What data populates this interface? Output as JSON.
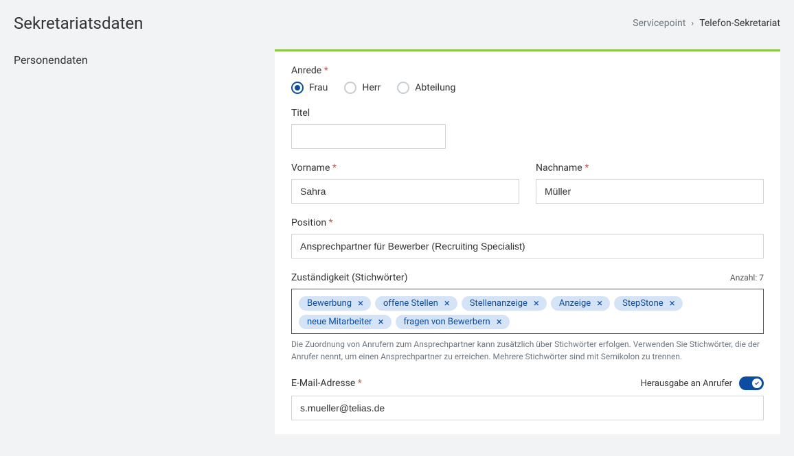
{
  "header": {
    "title": "Sekretariatsdaten",
    "breadcrumb": {
      "parent": "Servicepoint",
      "current": "Telefon-Sekretariat"
    }
  },
  "sidebar": {
    "items": [
      {
        "label": "Personendaten"
      }
    ]
  },
  "form": {
    "salutation": {
      "label": "Anrede",
      "options": [
        {
          "label": "Frau",
          "value": "frau",
          "checked": true
        },
        {
          "label": "Herr",
          "value": "herr",
          "checked": false
        },
        {
          "label": "Abteilung",
          "value": "abteilung",
          "checked": false
        }
      ]
    },
    "title": {
      "label": "Titel",
      "value": ""
    },
    "firstname": {
      "label": "Vorname",
      "value": "Sahra"
    },
    "lastname": {
      "label": "Nachname",
      "value": "Müller"
    },
    "position": {
      "label": "Position",
      "value": "Ansprechpartner für Bewerber (Recruiting Specialist)"
    },
    "keywords": {
      "label": "Zuständigkeit (Stichwörter)",
      "count_label": "Anzahl:",
      "count": 7,
      "tags": [
        "Bewerbung",
        "offene Stellen",
        "Stellenanzeige",
        "Anzeige",
        "StepStone",
        "neue Mitarbeiter",
        "fragen von Bewerbern"
      ],
      "help": "Die Zuordnung von Anrufern zum Ansprechpartner kann zusätzlich über Stichwörter erfolgen. Verwenden Sie Stichwörter, die der Anrufer nennt, um einen Ansprechpartner zu erreichen. Mehrere Stichwörter sind mit Semikolon zu trennen."
    },
    "email": {
      "label": "E-Mail-Adresse",
      "value": "s.mueller@telias.de",
      "disclosure_label": "Herausgabe an Anrufer",
      "disclosure_on": true
    }
  }
}
